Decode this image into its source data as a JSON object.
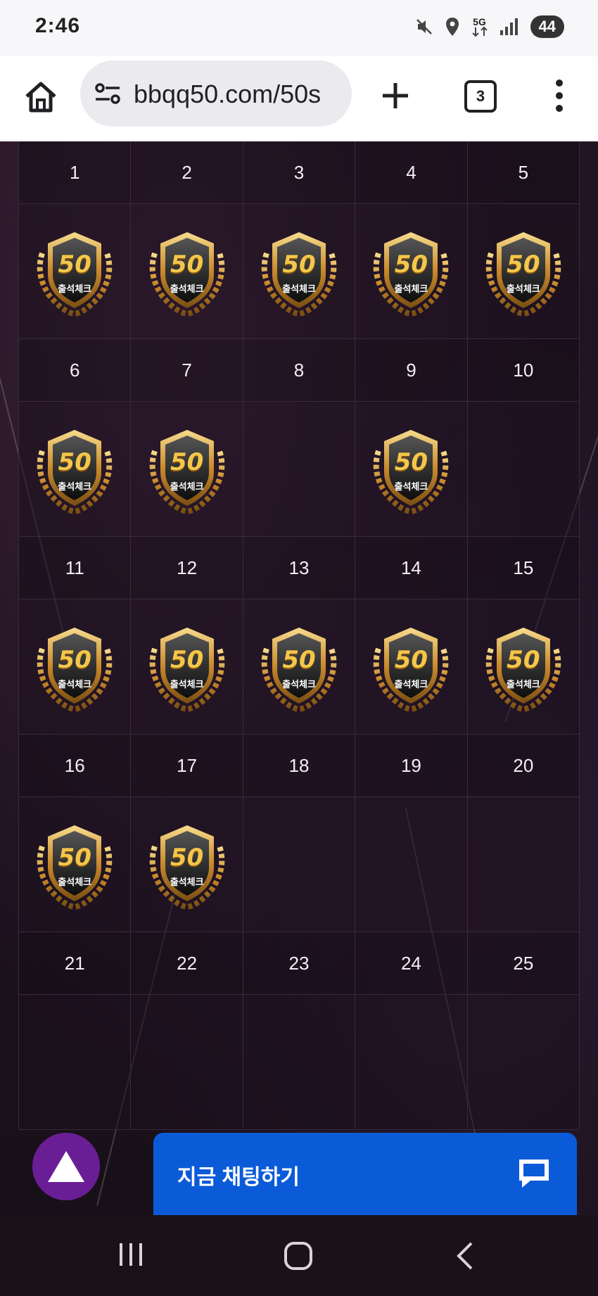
{
  "status": {
    "time": "2:46",
    "network": "5G",
    "battery": "44"
  },
  "browser": {
    "url": "bbqq50.com/50s",
    "tab_count": "3"
  },
  "calendar": {
    "badge_number": "50",
    "badge_text": "출석체크",
    "weeks": [
      {
        "days": [
          {
            "n": "1",
            "checked": true
          },
          {
            "n": "2",
            "checked": true
          },
          {
            "n": "3",
            "checked": true
          },
          {
            "n": "4",
            "checked": true
          },
          {
            "n": "5",
            "checked": true
          }
        ]
      },
      {
        "days": [
          {
            "n": "6",
            "checked": true
          },
          {
            "n": "7",
            "checked": true
          },
          {
            "n": "8",
            "checked": false
          },
          {
            "n": "9",
            "checked": true
          },
          {
            "n": "10",
            "checked": false
          }
        ]
      },
      {
        "days": [
          {
            "n": "11",
            "checked": true
          },
          {
            "n": "12",
            "checked": true
          },
          {
            "n": "13",
            "checked": true
          },
          {
            "n": "14",
            "checked": true
          },
          {
            "n": "15",
            "checked": true
          }
        ]
      },
      {
        "days": [
          {
            "n": "16",
            "checked": true
          },
          {
            "n": "17",
            "checked": true
          },
          {
            "n": "18",
            "checked": false
          },
          {
            "n": "19",
            "checked": false
          },
          {
            "n": "20",
            "checked": false
          }
        ]
      },
      {
        "days": [
          {
            "n": "21",
            "checked": false
          },
          {
            "n": "22",
            "checked": false
          },
          {
            "n": "23",
            "checked": false
          },
          {
            "n": "24",
            "checked": false
          },
          {
            "n": "25",
            "checked": false
          }
        ]
      }
    ]
  },
  "chat": {
    "label": "지금 채팅하기"
  },
  "colors": {
    "chat_blue": "#0b5bd9",
    "fab_purple": "#6a1e96",
    "badge_gold": "#d9a441"
  },
  "icons": [
    "home-icon",
    "site-info-icon",
    "plus-icon",
    "menu-dots-icon",
    "chat-bubble-icon",
    "recent-apps-icon",
    "home-circle-icon",
    "back-icon"
  ]
}
